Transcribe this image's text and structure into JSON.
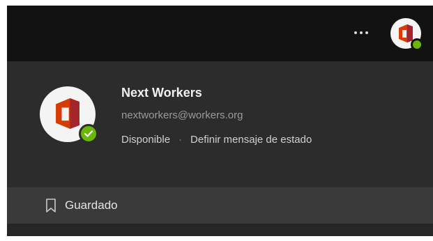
{
  "header": {
    "more_icon": "more-horizontal-icon",
    "more_glyph": "···",
    "avatar_icon": "office-logo-icon"
  },
  "profile": {
    "name": "Next Workers",
    "email": "nextworkers@workers.org",
    "status": "Disponible",
    "separator": "·",
    "status_message_link": "Definir mensaje de estado",
    "presence_color": "#6bb700",
    "brand_color": "#d83b01"
  },
  "menu": {
    "saved_icon": "bookmark-icon",
    "saved_label": "Guardado"
  }
}
